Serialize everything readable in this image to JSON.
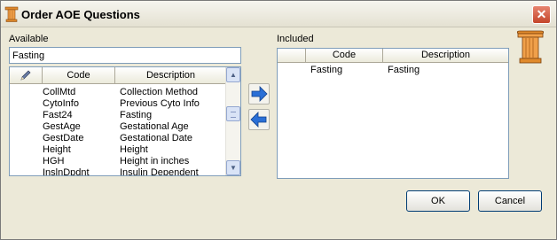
{
  "window": {
    "title": "Order AOE Questions",
    "close_glyph": "✕"
  },
  "available": {
    "label": "Available",
    "filter_value": "Fasting",
    "columns": {
      "code": "Code",
      "description": "Description"
    },
    "rows": [
      {
        "code": "CollMtd",
        "description": "Collection Method"
      },
      {
        "code": "CytoInfo",
        "description": "Previous Cyto Info"
      },
      {
        "code": "Fast24",
        "description": "Fasting"
      },
      {
        "code": "GestAge",
        "description": "Gestational Age"
      },
      {
        "code": "GestDate",
        "description": "Gestational Date"
      },
      {
        "code": "Height",
        "description": "Height"
      },
      {
        "code": "HGH",
        "description": "Height in inches"
      },
      {
        "code": "InslnDpdnt",
        "description": "Insulin Dependent"
      }
    ]
  },
  "included": {
    "label": "Included",
    "columns": {
      "code": "Code",
      "description": "Description"
    },
    "rows": [
      {
        "code": "Fasting",
        "description": "Fasting"
      }
    ]
  },
  "buttons": {
    "ok": "OK",
    "cancel": "Cancel"
  },
  "icons": {
    "title": "column-icon",
    "add": "arrow-right-icon",
    "remove": "arrow-left-icon",
    "brand": "column-logo-icon",
    "column_header": "pencil-icon"
  },
  "colors": {
    "arrow_blue": "#2a6fd6",
    "close_red": "#c44529",
    "column_orange": "#e08a2c"
  }
}
